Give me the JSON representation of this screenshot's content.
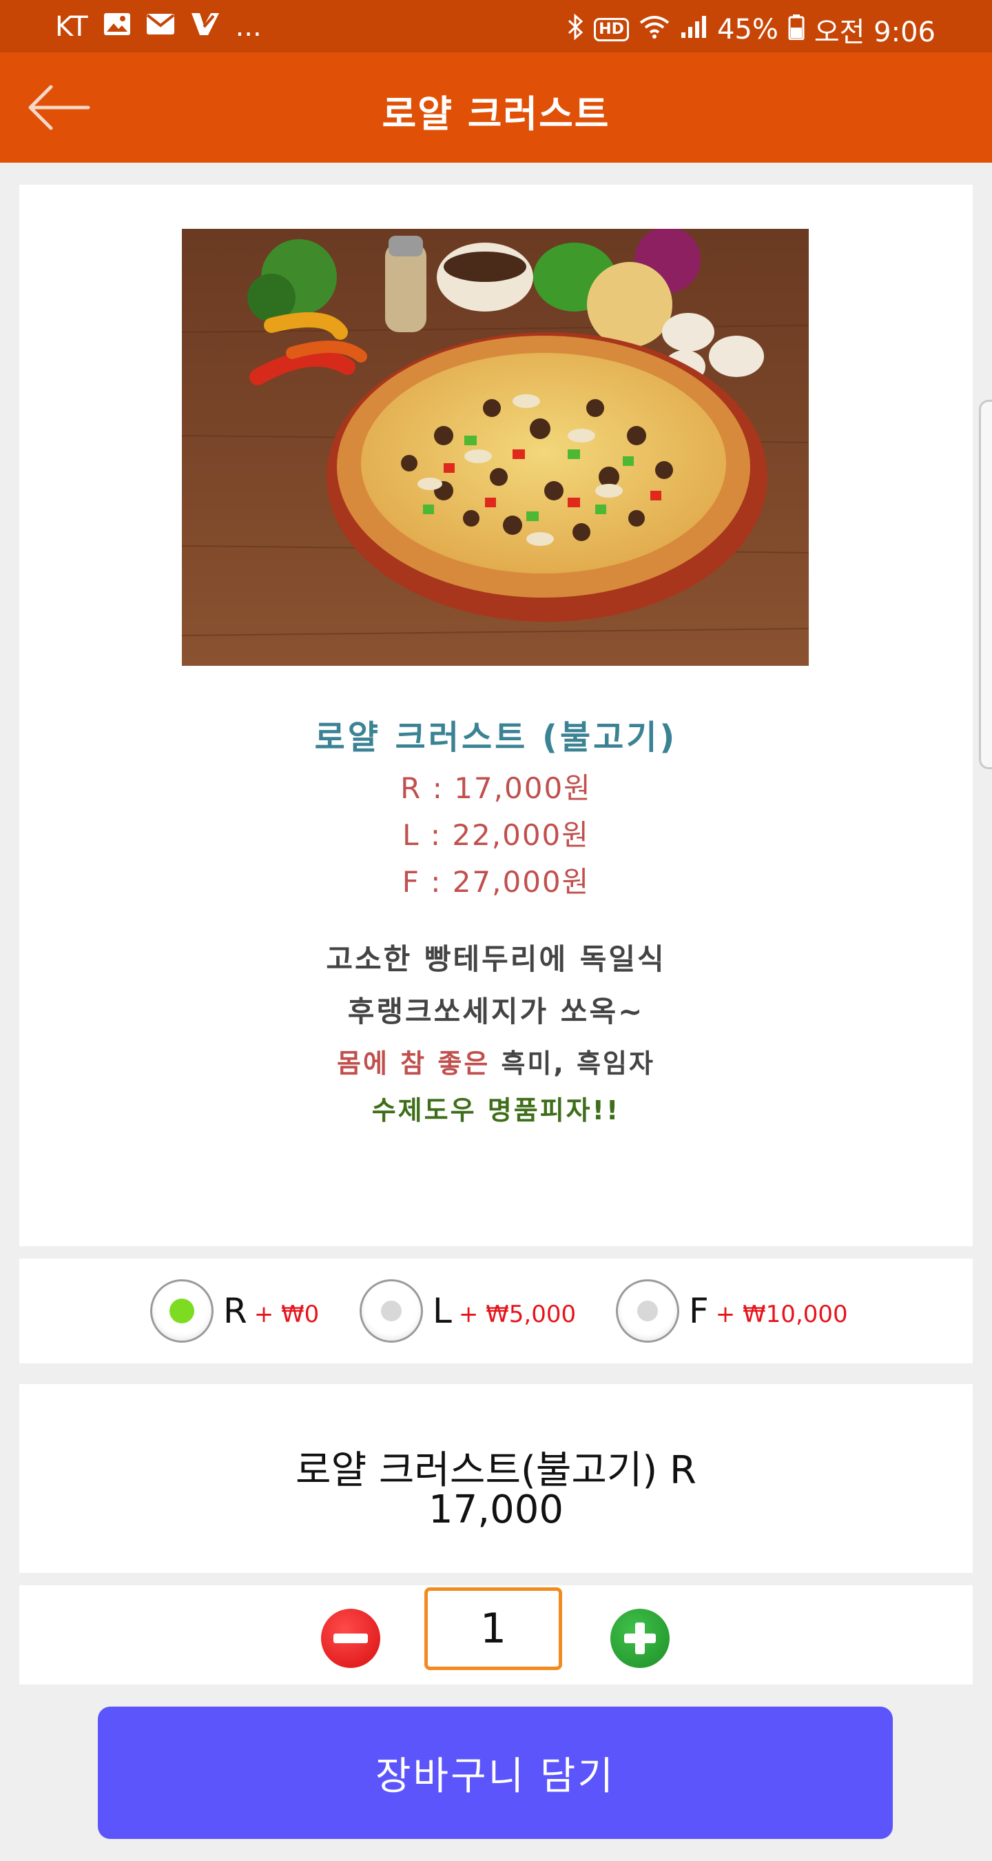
{
  "status_bar": {
    "carrier": "KT",
    "more": "...",
    "hd": "HD",
    "battery": "45%",
    "time": "오전 9:06"
  },
  "toolbar": {
    "title": "로얄 크러스트",
    "back_icon": "arrow-left-icon"
  },
  "product": {
    "image_alt": "pizza photo",
    "name": "로얄 크러스트 (불고기)",
    "prices": [
      "R : 17,000원",
      "L : 22,000원",
      "F : 27,000원"
    ],
    "description": {
      "line1": "고소한 빵테두리에 독일식",
      "line2": "후랭크쏘세지가 쏘옥~",
      "line3_highlight": "몸에 참 좋은",
      "line3_rest": " 흑미, 흑임자",
      "line4": "수제도우 명품피자!!"
    }
  },
  "size_options": [
    {
      "label": "R",
      "extra": "+ ₩0",
      "checked": true
    },
    {
      "label": "L",
      "extra": "+ ₩5,000",
      "checked": false
    },
    {
      "label": "F",
      "extra": "+ ₩10,000",
      "checked": false
    }
  ],
  "summary": {
    "name": "로얄 크러스트(불고기) R",
    "price": "17,000"
  },
  "quantity": {
    "value": "1"
  },
  "cart_button": {
    "label": "장바구니 담기"
  },
  "colors": {
    "status_bar": "#c74505",
    "toolbar": "#e05006",
    "product_name": "#3b8394",
    "price": "#c0504d",
    "option_extra": "#e6141b",
    "cart_button": "#5c55fb",
    "qty_border": "#f28a1f"
  }
}
